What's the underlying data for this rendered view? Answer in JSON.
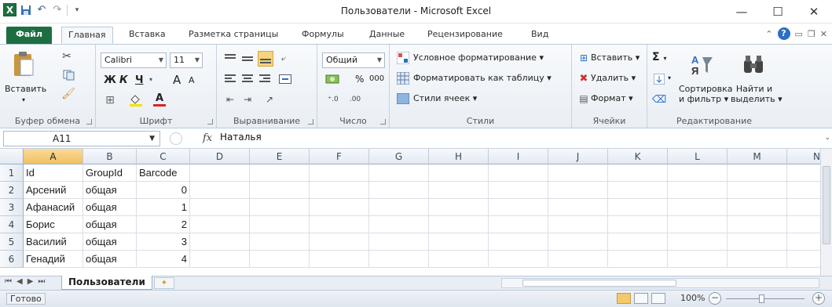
{
  "window": {
    "title": "Пользователи - Microsoft Excel",
    "logo_letter": "X",
    "minimize": "—",
    "maximize": "☐",
    "close": "✕"
  },
  "tabs": [
    "Файл",
    "Главная",
    "Вставка",
    "Разметка страницы",
    "Формулы",
    "Данные",
    "Рецензирование",
    "Вид"
  ],
  "ribbon": {
    "clipboard": {
      "label": "Буфер обмена",
      "paste": "Вставить"
    },
    "font": {
      "label": "Шрифт",
      "name": "Calibri",
      "size": "11",
      "bold": "Ж",
      "italic": "К",
      "underline": "Ч",
      "grow": "A",
      "shrink": "A"
    },
    "alignment": {
      "label": "Выравнивание"
    },
    "number": {
      "label": "Число",
      "format": "Общий",
      "percent": "%",
      "thousands": "000"
    },
    "styles": {
      "label": "Стили",
      "conditional": "Условное форматирование",
      "as_table": "Форматировать как таблицу",
      "cell_styles": "Стили ячеек"
    },
    "cells": {
      "label": "Ячейки",
      "insert": "Вставить",
      "delete": "Удалить",
      "format": "Формат"
    },
    "editing": {
      "label": "Редактирование",
      "sort_l1": "Сортировка",
      "sort_l2": "и фильтр",
      "find_l1": "Найти и",
      "find_l2": "выделить",
      "sigma": "Σ"
    }
  },
  "formula_bar": {
    "name_box": "A11",
    "fx": "fx",
    "content": "Наталья"
  },
  "sheet": {
    "columns": [
      "A",
      "B",
      "C",
      "D",
      "E",
      "F",
      "G",
      "H",
      "I",
      "J",
      "K",
      "L",
      "M",
      "N"
    ],
    "row_numbers": [
      "1",
      "2",
      "3",
      "4",
      "5",
      "6"
    ],
    "rows": [
      [
        "Id",
        "GroupId",
        "Barcode"
      ],
      [
        "Арсений",
        "общая",
        "0"
      ],
      [
        "Афанасий",
        "общая",
        "1"
      ],
      [
        "Борис",
        "общая",
        "2"
      ],
      [
        "Василий",
        "общая",
        "3"
      ],
      [
        "Генадий",
        "общая",
        "4"
      ]
    ]
  },
  "sheet_tabs": {
    "active": "Пользователи"
  },
  "status": {
    "ready": "Готово",
    "zoom": "100%",
    "zoom_minus": "−",
    "zoom_plus": "+"
  }
}
